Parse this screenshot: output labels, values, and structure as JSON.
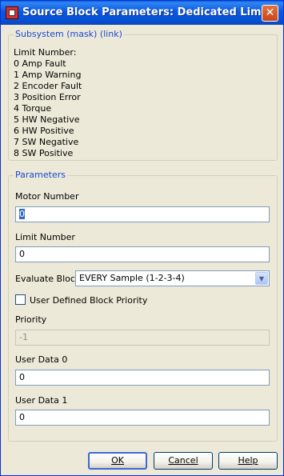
{
  "window": {
    "title": "Source Block Parameters: Dedicated Limit",
    "close_glyph": "✕"
  },
  "description": {
    "header": "Subsystem (mask) (link)",
    "lines": [
      "Limit Number:",
      "0 Amp Fault",
      "1 Amp Warning",
      "2 Encoder Fault",
      "3 Position Error",
      "4 Torque",
      "5 HW Negative",
      "6 HW Positive",
      "7 SW Negative",
      "8 SW Positive"
    ]
  },
  "parameters": {
    "header": "Parameters",
    "motor_number": {
      "label": "Motor Number",
      "value": "0"
    },
    "limit_number": {
      "label": "Limit Number",
      "value": "0"
    },
    "evaluate_block": {
      "label": "Evaluate Block",
      "selected": "EVERY Sample (1-2-3-4)"
    },
    "user_defined_priority": {
      "label": "User Defined Block Priority",
      "checked": false
    },
    "priority": {
      "label": "Priority",
      "value": "-1"
    },
    "user_data_0": {
      "label": "User Data 0",
      "value": "0"
    },
    "user_data_1": {
      "label": "User Data 1",
      "value": "0"
    }
  },
  "buttons": {
    "ok": "OK",
    "cancel": "Cancel",
    "help": "Help"
  },
  "colors": {
    "titlebar": "#0b58e0",
    "group_header": "#1c48d3",
    "face": "#ece9d8"
  },
  "icons": {
    "app": "simulink-block-icon",
    "close": "close-icon",
    "dropdown": "chevron-down-icon"
  }
}
